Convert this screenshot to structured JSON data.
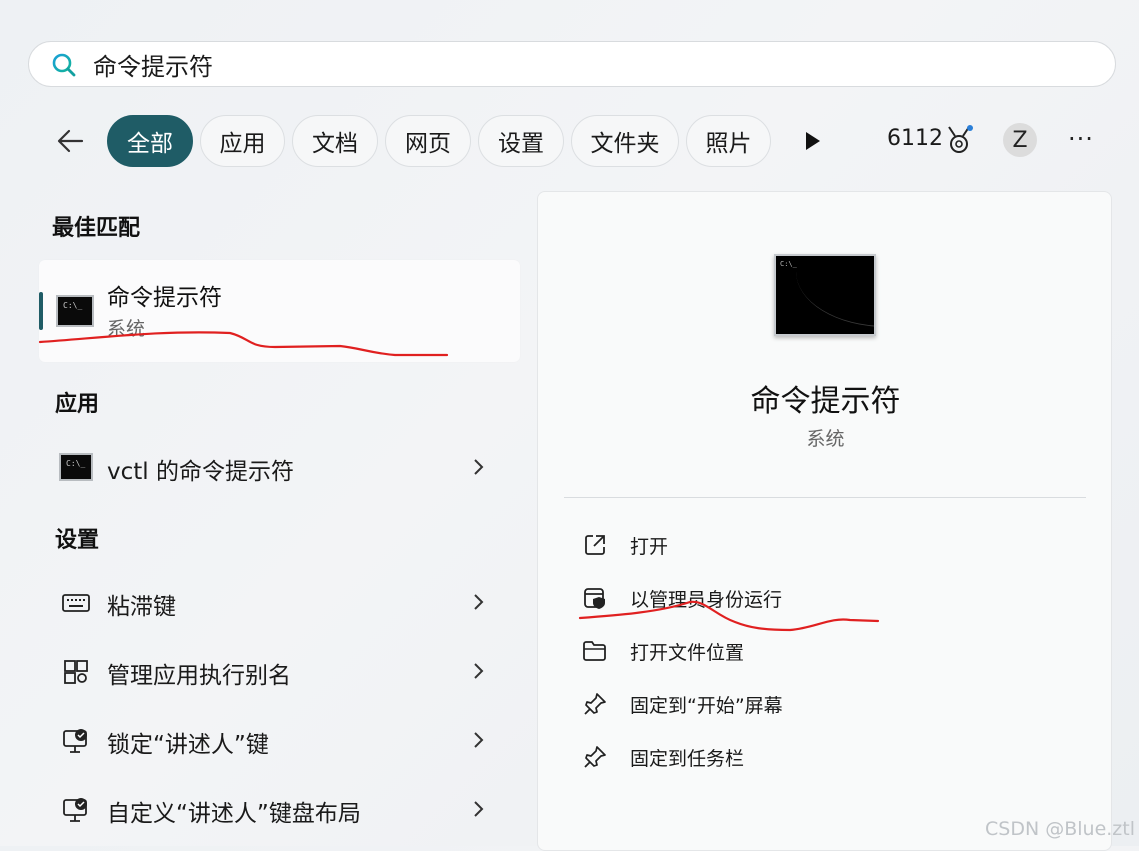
{
  "search": {
    "value": "命令提示符"
  },
  "filters": [
    "全部",
    "应用",
    "文档",
    "网页",
    "设置",
    "文件夹",
    "照片"
  ],
  "header": {
    "points": "6112",
    "avatar_initial": "Z",
    "more": "···"
  },
  "best_match": {
    "heading": "最佳匹配",
    "title": "命令提示符",
    "subtitle": "系统",
    "icon": "cmd-icon"
  },
  "apps": {
    "heading": "应用",
    "items": [
      {
        "label": "vctl 的命令提示符",
        "icon": "cmd-icon"
      }
    ]
  },
  "settings": {
    "heading": "设置",
    "items": [
      {
        "label": "粘滞键",
        "icon": "keyboard-icon"
      },
      {
        "label": "管理应用执行别名",
        "icon": "app-alias-icon"
      },
      {
        "label": "锁定“讲述人”键",
        "icon": "narrator-icon"
      },
      {
        "label": "自定义“讲述人”键盘布局",
        "icon": "narrator-icon"
      }
    ]
  },
  "detail": {
    "title": "命令提示符",
    "subtitle": "系统",
    "actions": [
      {
        "label": "打开",
        "icon": "open-external-icon"
      },
      {
        "label": "以管理员身份运行",
        "icon": "admin-shield-icon"
      },
      {
        "label": "打开文件位置",
        "icon": "folder-icon"
      },
      {
        "label": "固定到“开始”屏幕",
        "icon": "pin-icon"
      },
      {
        "label": "固定到任务栏",
        "icon": "pin-icon"
      }
    ]
  },
  "watermark": "CSDN @Blue.ztl",
  "colors": {
    "accent": "#1f5c66",
    "annotation": "#e02020"
  }
}
